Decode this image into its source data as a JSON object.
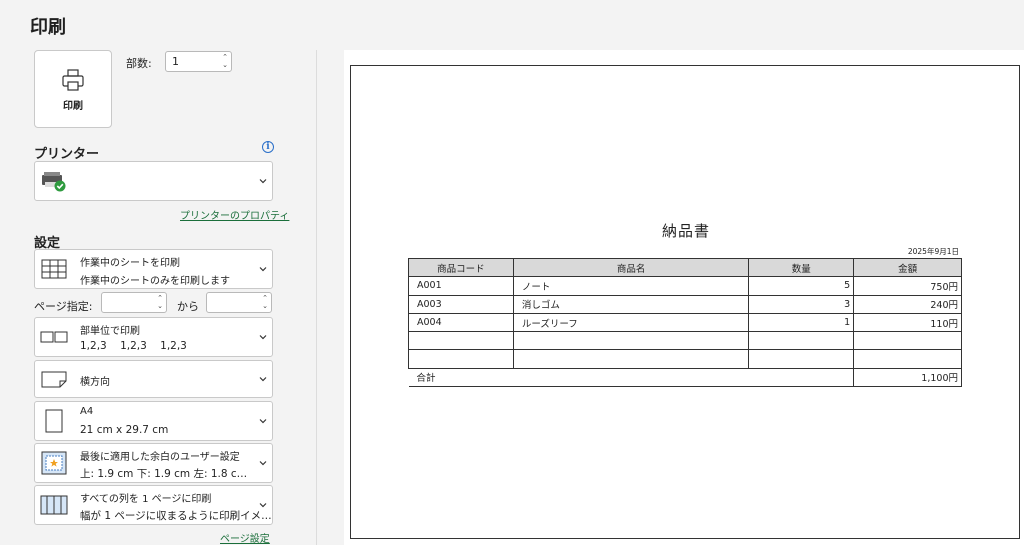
{
  "title": "印刷",
  "print_button": {
    "label": "印刷",
    "icon": "printer-icon"
  },
  "copies": {
    "label": "部数:",
    "value": "1"
  },
  "printer": {
    "heading": "プリンター",
    "properties_link": "プリンターのプロパティ"
  },
  "settings": {
    "heading": "設定",
    "what": {
      "main": "作業中のシートを印刷",
      "sub": "作業中のシートのみを印刷します"
    },
    "pages": {
      "label": "ページ指定:",
      "from": "",
      "to_label": "から",
      "to": ""
    },
    "collate": {
      "main": "部単位で印刷",
      "sub": "1,2,3    1,2,3    1,2,3"
    },
    "orientation": {
      "main": "横方向"
    },
    "paper": {
      "main": "A4",
      "sub": "21 cm x 29.7 cm"
    },
    "margins": {
      "main": "最後に適用した余白のユーザー設定",
      "sub": "上: 1.9 cm 下: 1.9 cm 左: 1.8 c…"
    },
    "scaling": {
      "main": "すべての列を 1 ページに印刷",
      "sub": "幅が 1 ページに収まるように印刷イメ…"
    },
    "page_setup_link": "ページ設定"
  },
  "document": {
    "title": "納品書",
    "date": "2025年9月1日",
    "headers": [
      "商品コード",
      "商品名",
      "数量",
      "金額"
    ],
    "rows": [
      {
        "code": "A001",
        "name": "ノート",
        "qty": "5",
        "amount": "750円"
      },
      {
        "code": "A003",
        "name": "消しゴム",
        "qty": "3",
        "amount": "240円"
      },
      {
        "code": "A004",
        "name": "ルーズリーフ",
        "qty": "1",
        "amount": "110円"
      },
      {
        "code": "",
        "name": "",
        "qty": "",
        "amount": ""
      },
      {
        "code": "",
        "name": "",
        "qty": "",
        "amount": ""
      }
    ],
    "total_label": "合計",
    "total_amount": "1,100円"
  },
  "colors": {
    "link": "#1a6e3a",
    "info": "#2a6fc9",
    "header_fill": "#d9d9d9"
  }
}
